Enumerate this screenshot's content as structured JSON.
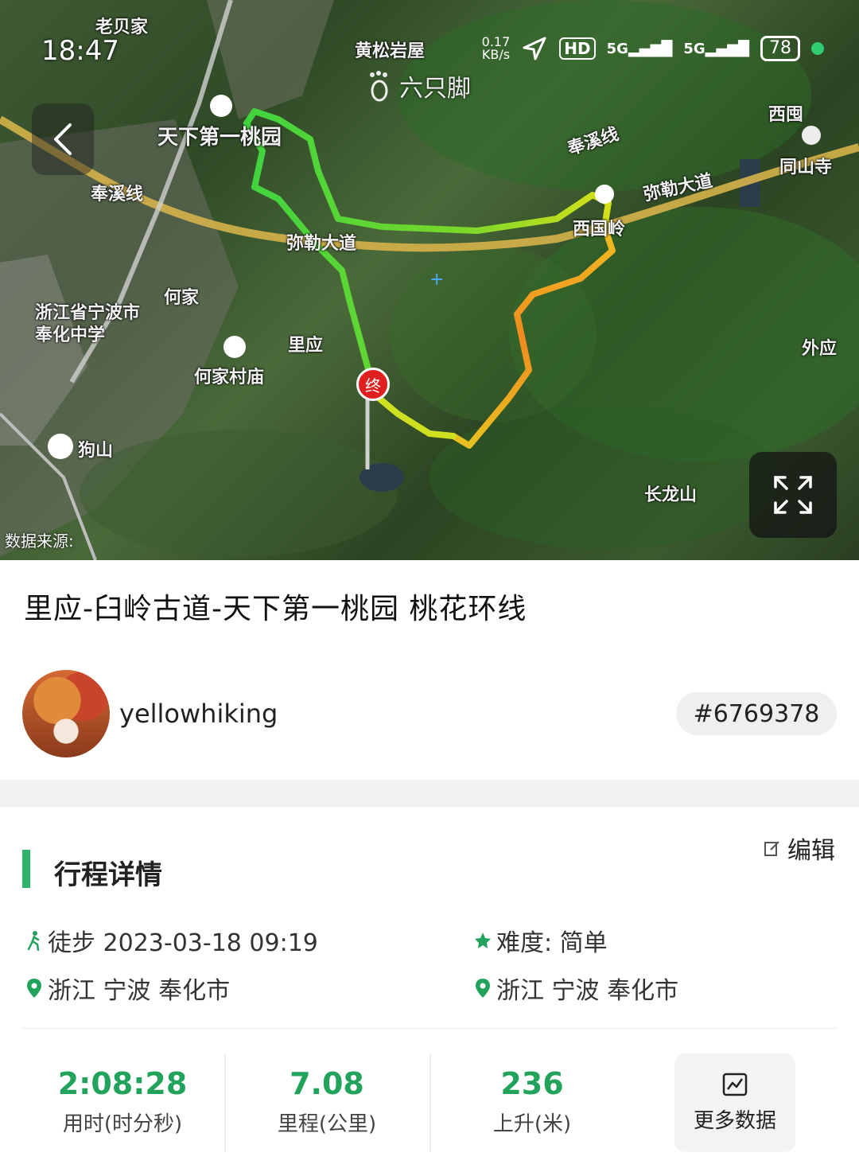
{
  "status_bar": {
    "time": "18:47",
    "net_speed_value": "0.17",
    "net_speed_unit": "KB/s",
    "hd_label": "HD",
    "sim1": "5G",
    "sim2": "5G",
    "battery": "78"
  },
  "map": {
    "watermark": "六只脚",
    "data_source": "数据来源:",
    "end_marker": "终",
    "labels": {
      "laobeijia": "老贝家",
      "huangsongyanwu": "黄松岩屋",
      "xidun": "西囤",
      "tongshansi": "同山寺",
      "tianxia_taoyuan": "天下第一桃园",
      "fengxi_line_left": "奉溪线",
      "fengxi_line_right": "奉溪线",
      "mile_road_left": "弥勒大道",
      "mile_road_right": "弥勒大道",
      "xiqiuling": "西国岭",
      "hejia": "何家",
      "school": "浙江省宁波市奉化中学",
      "liying": "里应",
      "hejia_temple": "何家村庙",
      "waiying": "外应",
      "goushan": "狗山",
      "changlongshan": "长龙山"
    }
  },
  "route": {
    "title": "里应-臼岭古道-天下第一桃园 桃花环线",
    "username": "yellowhiking",
    "track_id": "#6769378"
  },
  "details": {
    "section_title": "行程详情",
    "edit_label": "编辑",
    "activity": "徒步 2023-03-18 09:19",
    "difficulty": "难度: 简单",
    "start_location": "浙江 宁波 奉化市",
    "end_location": "浙江 宁波 奉化市"
  },
  "stats": [
    {
      "value": "2:08:28",
      "label": "用时(时分秒)"
    },
    {
      "value": "7.08",
      "label": "里程(公里)"
    },
    {
      "value": "236",
      "label": "上升(米)"
    }
  ],
  "more_data_label": "更多数据",
  "colors": {
    "accent_green": "#21a35c",
    "section_bar": "#2db46a",
    "track_green": "#3fd33f",
    "track_yellow": "#d8e01a",
    "track_orange": "#f08a20"
  }
}
